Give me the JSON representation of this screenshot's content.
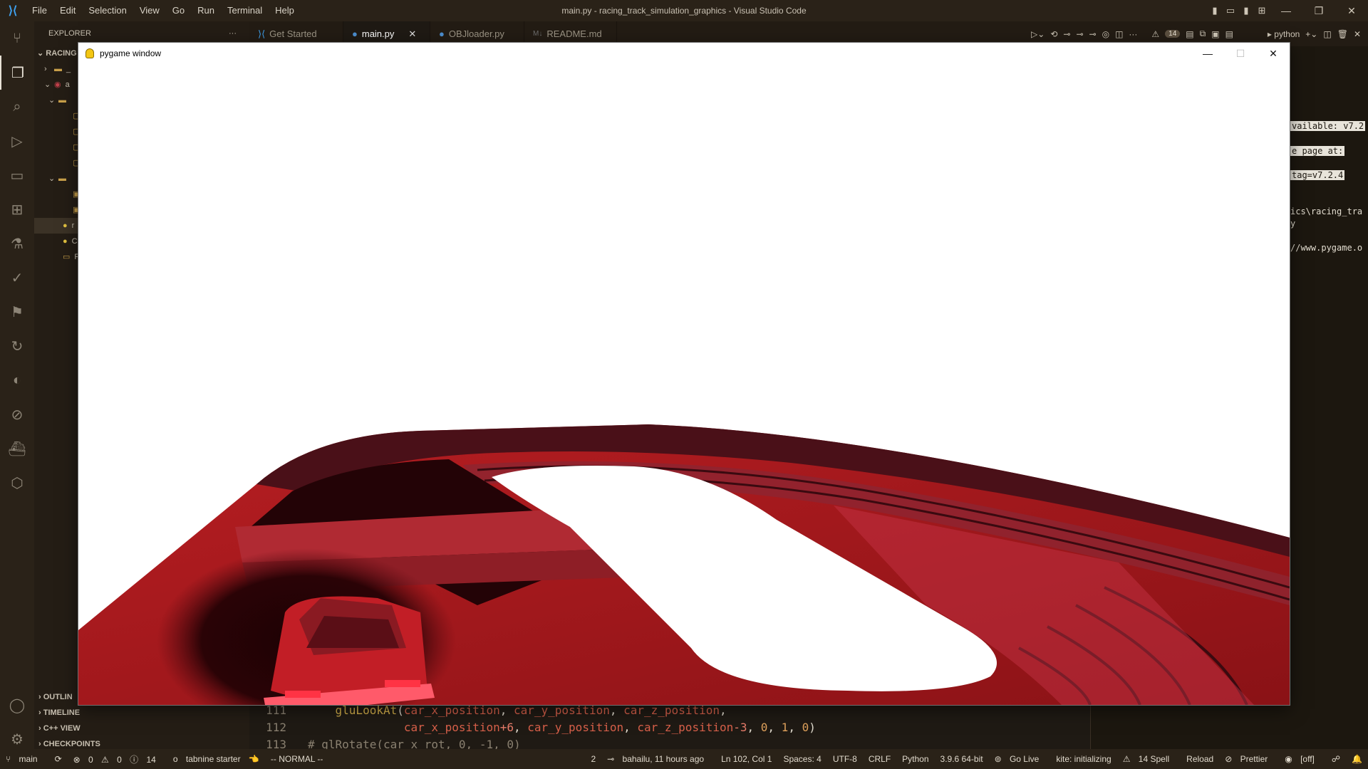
{
  "titlebar": {
    "window_title": "main.py - racing_track_simulation_graphics - Visual Studio Code",
    "menu": [
      "File",
      "Edit",
      "Selection",
      "View",
      "Go",
      "Run",
      "Terminal",
      "Help"
    ]
  },
  "activity_bar": [
    "source-control-icon",
    "explorer-icon",
    "search-icon",
    "run-debug-icon",
    "remote-explorer-icon",
    "extensions-icon",
    "testing-icon",
    "git-graph-icon",
    "bookmarks-icon",
    "live-share-icon",
    "gitlens-icon",
    "kite-icon",
    "docker-icon",
    "codestream-icon",
    "accounts-icon",
    "settings-icon"
  ],
  "sidebar": {
    "title": "EXPLORER",
    "more": "···",
    "workspace": "RACING",
    "tree": [
      {
        "indent": 14,
        "chev": "›",
        "icon": "▬",
        "label": "_"
      },
      {
        "indent": 14,
        "chev": "⌄",
        "icon": "◉",
        "label": "a"
      },
      {
        "indent": 20,
        "chev": "⌄",
        "icon": "▬",
        "label": ""
      },
      {
        "indent": 40,
        "chev": "",
        "icon": "▢",
        "label": ""
      },
      {
        "indent": 40,
        "chev": "",
        "icon": "▢",
        "label": ""
      },
      {
        "indent": 40,
        "chev": "",
        "icon": "▢",
        "label": ""
      },
      {
        "indent": 40,
        "chev": "",
        "icon": "▢",
        "label": ""
      },
      {
        "indent": 20,
        "chev": "⌄",
        "icon": "▬",
        "label": ""
      },
      {
        "indent": 40,
        "chev": "",
        "icon": "▣",
        "label": ""
      },
      {
        "indent": 40,
        "chev": "",
        "icon": "▣",
        "label": ""
      },
      {
        "indent": 26,
        "chev": "",
        "icon": "●",
        "label": "r"
      },
      {
        "indent": 26,
        "chev": "",
        "icon": "●",
        "label": "C"
      },
      {
        "indent": 26,
        "chev": "",
        "icon": "▭",
        "label": "R"
      }
    ],
    "sections": [
      "OUTLIN",
      "TIMELINE",
      "C++ VIEW",
      "CHECKPOINTS"
    ]
  },
  "tabs": [
    {
      "label": "Get Started",
      "icon": "vscode-icon",
      "active": false
    },
    {
      "label": "main.py",
      "icon": "python-icon",
      "active": true,
      "close": "✕"
    },
    {
      "label": "OBJloader.py",
      "icon": "python-icon",
      "active": false
    },
    {
      "label": "README.md",
      "icon": "markdown-icon",
      "active": false
    }
  ],
  "editor_actions": {
    "problems_count": "14",
    "terminal_profile": "python"
  },
  "terminal_lines": [
    {
      "text": "vailable: v7.2",
      "hl": true
    },
    {
      "text": "e page at:",
      "hl": true
    },
    {
      "text": "tag=v7.2.4",
      "hl": true
    },
    {
      "text": "ics\\racing_tra",
      "hl": false
    },
    {
      "text": "y",
      "hl": false
    },
    {
      "text": "//www.pygame.o",
      "hl": false
    }
  ],
  "code": {
    "line111": {
      "num": "111",
      "fn": "gluLookAt",
      "open": "(",
      "a1": "car_x_position",
      "a2": "car_y_position",
      "a3": "car_z_position",
      "tail": ","
    },
    "line112": {
      "num": "112",
      "a1": "car_x_position",
      "op1": "+6",
      "a2": "car_y_position",
      "a3": "car_z_position",
      "op3": "-3",
      "n1": "0",
      "n2": "1",
      "n3": "0",
      "close": ")"
    },
    "line113": {
      "num": "113",
      "comment": "# glRotate(car_x_rot, 0, -1, 0)"
    }
  },
  "pygame": {
    "title": "pygame window",
    "minimize": "—",
    "maximize": "☐",
    "close": "✕"
  },
  "statusbar": {
    "branch": "main",
    "sync": "⟳",
    "errors": "0",
    "warnings": "0",
    "infos": "14",
    "tabnine": "tabnine starter",
    "vim_mode": "-- NORMAL --",
    "selection_count": "2",
    "blame": "bahailu, 11 hours ago",
    "cursor": "Ln 102, Col 1",
    "spaces": "Spaces: 4",
    "encoding": "UTF-8",
    "eol": "CRLF",
    "language": "Python",
    "interpreter": "3.9.6 64-bit",
    "go_live": "Go Live",
    "kite": "kite: initializing",
    "spell": "14 Spell",
    "reload": "Reload",
    "prettier": "Prettier",
    "off": "[off]"
  },
  "colors": {
    "accent": "#3fa2f0",
    "track_red": "#b01a1e",
    "track_dark": "#4a0c10",
    "title_bg": "#2a2218"
  }
}
